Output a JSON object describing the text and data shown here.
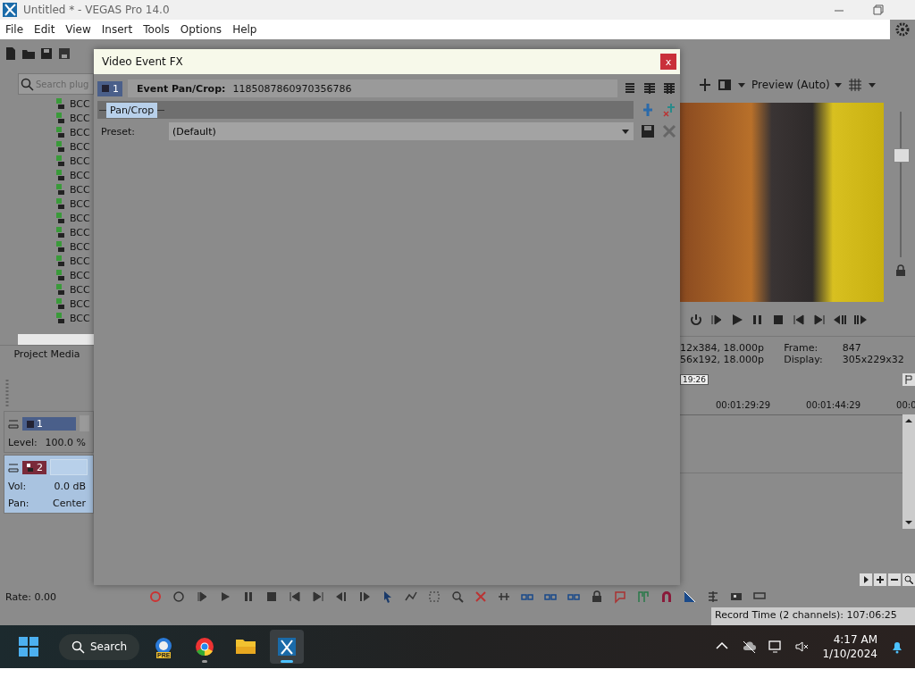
{
  "app_window": {
    "title": "Untitled * - VEGAS Pro 14.0"
  },
  "menu": [
    "File",
    "Edit",
    "View",
    "Insert",
    "Tools",
    "Options",
    "Help"
  ],
  "plugin_panel": {
    "search_placeholder": "Search plug",
    "items": [
      "BCC",
      "BCC",
      "BCC",
      "BCC",
      "BCC",
      "BCC",
      "BCC",
      "BCC",
      "BCC",
      "BCC",
      "BCC",
      "BCC",
      "BCC",
      "BCC",
      "BCC",
      "BCC"
    ],
    "tab": "Project Media"
  },
  "tracks": [
    {
      "kind": "video",
      "number": "1",
      "selected": false,
      "fields": [
        {
          "label": "Level:",
          "value": "100.0 %"
        }
      ]
    },
    {
      "kind": "audio",
      "number": "2",
      "selected": true,
      "fields": [
        {
          "label": "Vol:",
          "value": "0.0 dB"
        },
        {
          "label": "Pan:",
          "value": "Center"
        }
      ]
    }
  ],
  "rate": "Rate: 0.00",
  "preview": {
    "quality": "Preview (Auto)",
    "slider": {
      "level": 0.7
    },
    "info_left": [
      "12x384, 18.000p",
      "56x192, 18.000p"
    ],
    "info_right": [
      {
        "label": "Frame:",
        "value": "847"
      },
      {
        "label": "Display:",
        "value": "305x229x32"
      }
    ]
  },
  "timeline": {
    "cursor_time": "19:26",
    "ruler": [
      "00:01:29:29",
      "00:01:44:29",
      "00:0"
    ]
  },
  "status_bar": "Record Time (2 channels): 107:06:25",
  "dialog": {
    "title": "Video Event FX",
    "close": "x",
    "event_number": "1",
    "event_label": "Event Pan/Crop:",
    "event_id": "1185087860970356786",
    "chain": [
      {
        "label": "Pan/Crop",
        "selected": true
      }
    ],
    "preset_label": "Preset:",
    "preset_value": "(Default)"
  },
  "taskbar": {
    "search": "Search",
    "apps": [
      {
        "kind": "premiere",
        "badge": "PRE",
        "running": false,
        "active": false
      },
      {
        "kind": "chrome",
        "running": true,
        "active": false
      },
      {
        "kind": "explorer",
        "running": false,
        "active": false
      },
      {
        "kind": "vegas",
        "running": true,
        "active": true
      }
    ],
    "time": "4:17 AM",
    "date": "1/10/2024"
  }
}
